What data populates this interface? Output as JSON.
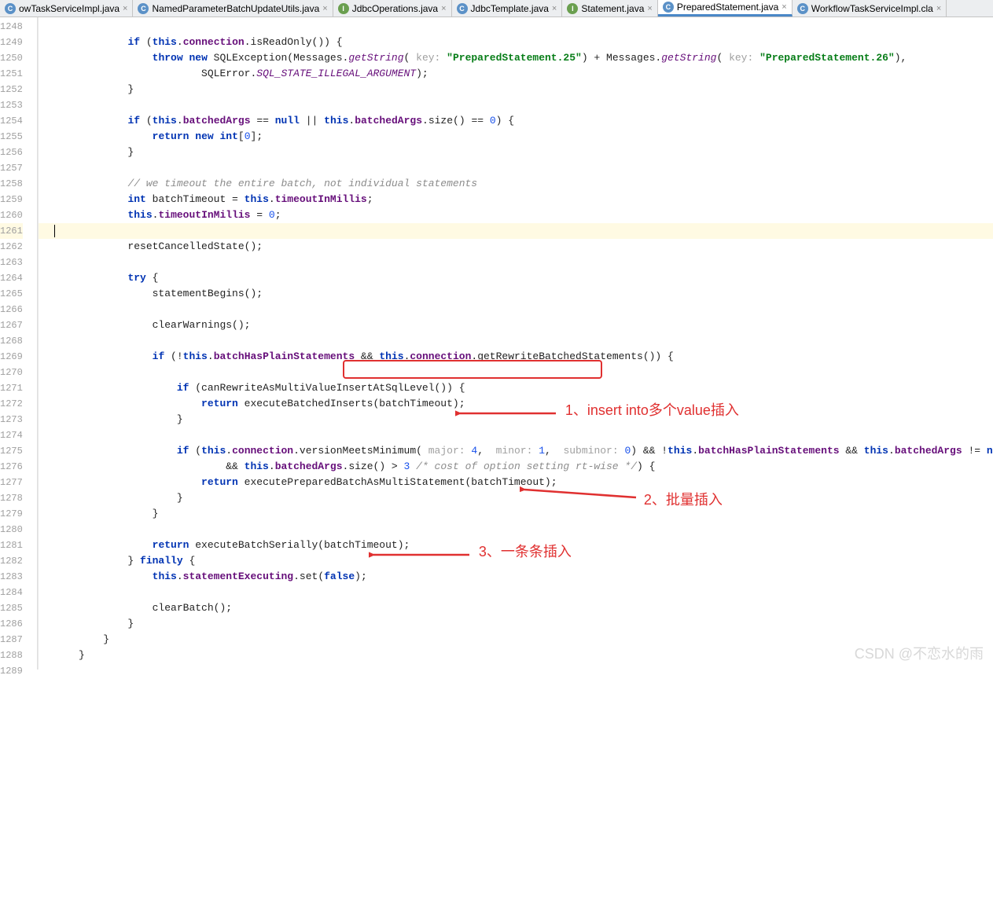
{
  "tabs": [
    {
      "name": "owTaskServiceImpl.java",
      "icon": "c"
    },
    {
      "name": "NamedParameterBatchUpdateUtils.java",
      "icon": "c"
    },
    {
      "name": "JdbcOperations.java",
      "icon": "i"
    },
    {
      "name": "JdbcTemplate.java",
      "icon": "c"
    },
    {
      "name": "Statement.java",
      "icon": "i"
    },
    {
      "name": "PreparedStatement.java",
      "icon": "c",
      "active": true
    },
    {
      "name": "WorkflowTaskServiceImpl.cla",
      "icon": "c"
    }
  ],
  "lines": {
    "start": 1248,
    "end": 1289,
    "highlighted": 1261
  },
  "code": {
    "l1249": {
      "kw1": "if",
      "kw2": "this",
      "fld": "connection",
      "call": "isReadOnly"
    },
    "l1250": {
      "kw1": "throw",
      "kw2": "new",
      "ex": "SQLException",
      "cls": "Messages",
      "m": "getString",
      "hint": "key:",
      "s1": "\"PreparedStatement.25\"",
      "s2": "\"PreparedStatement.26\""
    },
    "l1251": {
      "cls": "SQLError",
      "stat": "SQL_STATE_ILLEGAL_ARGUMENT"
    },
    "l1254": {
      "kw": "if",
      "kw2": "this",
      "fld": "batchedArgs",
      "kw3": "null",
      "m": "size",
      "n": "0"
    },
    "l1255": {
      "kw1": "return",
      "kw2": "new",
      "kw3": "int",
      "n": "0"
    },
    "l1258": {
      "cmt": "// we timeout the entire batch, not individual statements"
    },
    "l1259": {
      "kw": "int",
      "v": "batchTimeout",
      "kw2": "this",
      "fld": "timeoutInMillis"
    },
    "l1260": {
      "kw": "this",
      "fld": "timeoutInMillis",
      "n": "0"
    },
    "l1262": {
      "m": "resetCancelledState"
    },
    "l1264": {
      "kw": "try"
    },
    "l1265": {
      "m": "statementBegins"
    },
    "l1267": {
      "m": "clearWarnings"
    },
    "l1269": {
      "kw": "if",
      "kw2": "this",
      "fld1": "batchHasPlainStatements",
      "fld2": "connection",
      "m": "getRewriteBatchedStatements"
    },
    "l1271": {
      "kw": "if",
      "m": "canRewriteAsMultiValueInsertAtSqlLevel"
    },
    "l1272": {
      "kw": "return",
      "m": "executeBatchedInserts",
      "a": "batchTimeout"
    },
    "l1275": {
      "kw": "if",
      "kw2": "this",
      "fld": "connection",
      "m": "versionMeetsMinimum",
      "h1": "major:",
      "n1": "4",
      "h2": "minor:",
      "n2": "1",
      "h3": "subminor:",
      "n3": "0",
      "fld2": "batchHasPlainStatements",
      "fld3": "batchedArgs",
      "kw3": "null"
    },
    "l1276": {
      "kw": "this",
      "fld": "batchedArgs",
      "m": "size",
      "n": "3",
      "cmt": "/* cost of option setting rt-wise */"
    },
    "l1277": {
      "kw": "return",
      "m": "executePreparedBatchAsMultiStatement",
      "a": "batchTimeout"
    },
    "l1281": {
      "kw": "return",
      "m": "executeBatchSerially",
      "a": "batchTimeout"
    },
    "l1282": {
      "kw": "finally"
    },
    "l1283": {
      "kw": "this",
      "fld": "statementExecuting",
      "m": "set",
      "kw2": "false"
    },
    "l1285": {
      "m": "clearBatch"
    }
  },
  "annotations": {
    "a1": "1、insert into多个value插入",
    "a2": "2、批量插入",
    "a3": "3、一条条插入"
  },
  "watermark": "CSDN @不恋水的雨",
  "close_glyph": "×"
}
